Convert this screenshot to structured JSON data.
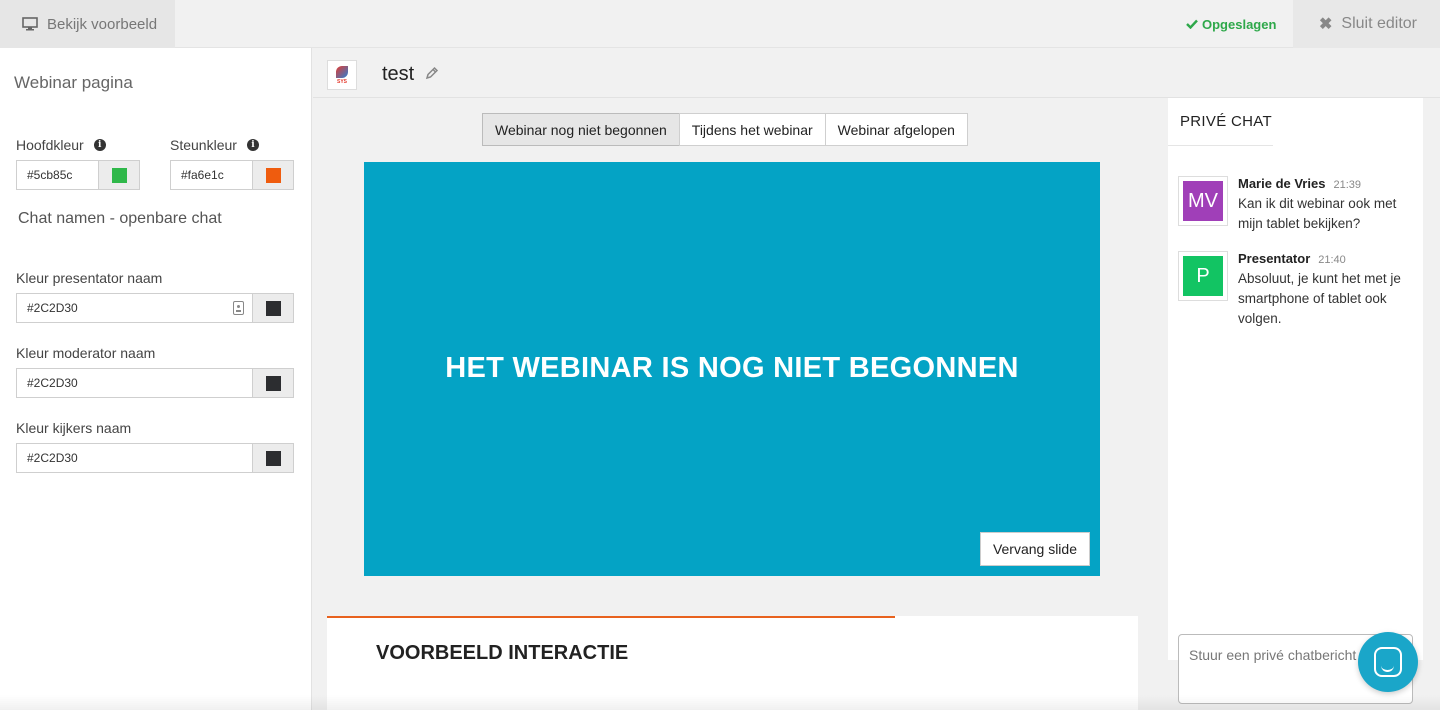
{
  "topbar": {
    "preview_label": "Bekijk voorbeeld",
    "saved_label": "Opgeslagen",
    "close_label": "Sluit editor"
  },
  "left_panel": {
    "title": "Webinar pagina",
    "main_color": {
      "label": "Hoofdkleur",
      "value": "#5cb85c",
      "swatch": "#2fb84a"
    },
    "accent_color": {
      "label": "Steunkleur",
      "value": "#fa6e1c",
      "swatch": "#ef5c0e"
    },
    "chat_section_title": "Chat namen - openbare chat",
    "presenter_name": {
      "label": "Kleur presentator naam",
      "value": "#2C2D30",
      "swatch": "#2C2D30"
    },
    "moderator_name": {
      "label": "Kleur moderator naam",
      "value": "#2C2D30",
      "swatch": "#2C2D30"
    },
    "viewers_name": {
      "label": "Kleur kijkers naam",
      "value": "#2C2D30",
      "swatch": "#2C2D30"
    }
  },
  "editor": {
    "logo_text": "SYS",
    "page_title": "test",
    "tabs": [
      {
        "label": "Webinar nog niet begonnen",
        "active": true
      },
      {
        "label": "Tijdens het webinar",
        "active": false
      },
      {
        "label": "Webinar afgelopen",
        "active": false
      }
    ],
    "slide": {
      "text": "HET WEBINAR IS NOG NIET BEGONNEN",
      "background": "#04a3c5",
      "replace_label": "Vervang slide"
    },
    "interaction_title": "VOORBEELD INTERACTIE",
    "interaction_accent": "#e8621e"
  },
  "chat": {
    "tab_label": "PRIVÉ CHAT",
    "messages": [
      {
        "initials": "MV",
        "avatar_color": "#a03fb8",
        "name": "Marie de Vries",
        "time": "21:39",
        "text": "Kan ik dit webinar ook met mijn tablet bekijken?"
      },
      {
        "initials": "P",
        "avatar_color": "#12c463",
        "name": "Presentator",
        "time": "21:40",
        "text": "Absoluut, je kunt het met je smartphone of tablet ook volgen."
      }
    ],
    "input_placeholder": "Stuur een privé chatbericht"
  }
}
